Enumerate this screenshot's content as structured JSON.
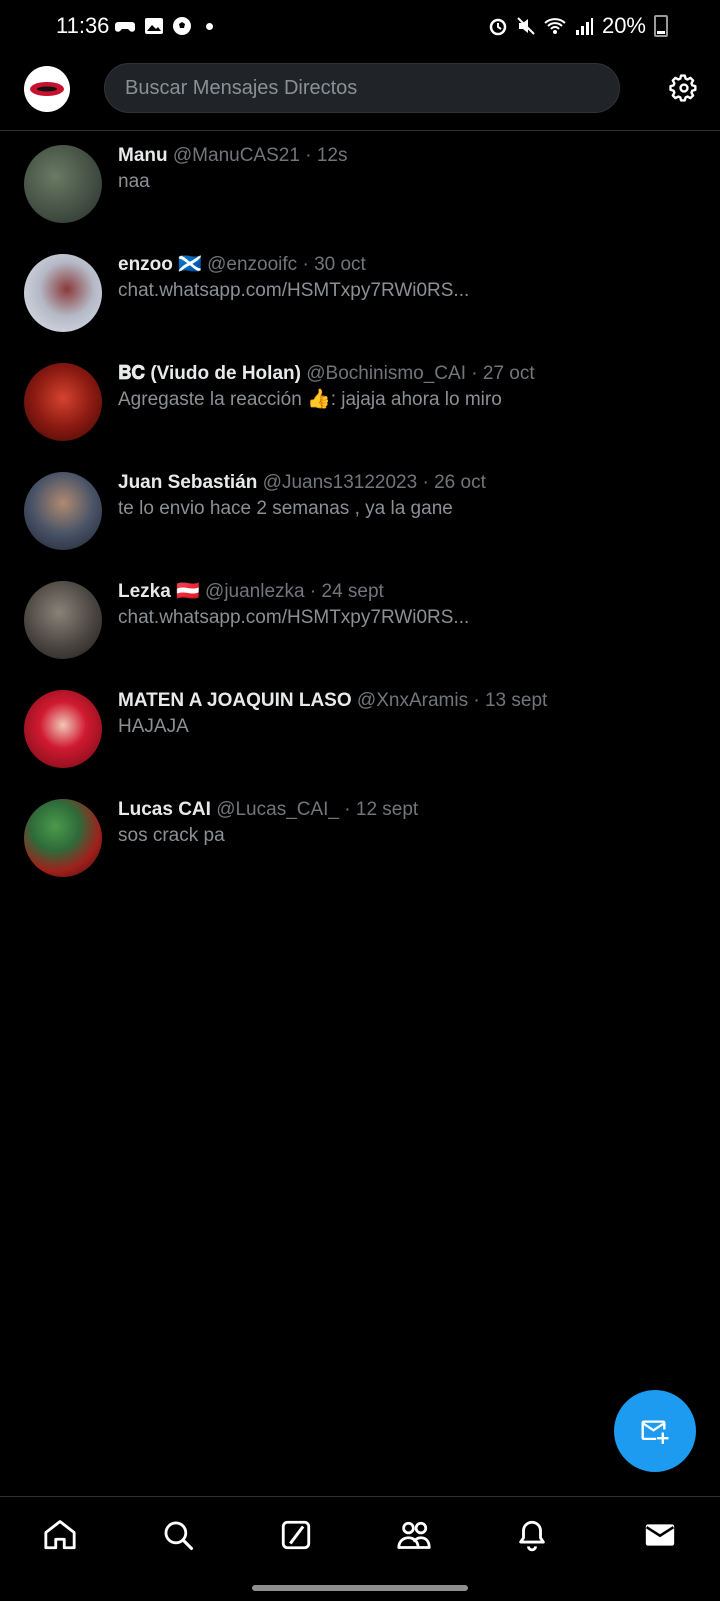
{
  "status_bar": {
    "time": "11:36",
    "battery": "20%"
  },
  "header": {
    "search_placeholder": "Buscar Mensajes Directos"
  },
  "conversations": [
    {
      "name": "Manu",
      "handle": "@ManuCAS21",
      "time": "12s",
      "preview": "naa",
      "avatar_color": "#3c4a3a"
    },
    {
      "name": "enzoo 🏴󠁧󠁢󠁳󠁣󠁴󠁿",
      "handle": "@enzooifc",
      "time": "30 oct",
      "preview": "chat.whatsapp.com/HSMTxpy7RWi0RS...",
      "avatar_color": "#c7cbd6"
    },
    {
      "name": "𝐁𝐂 (Viudo de Holan)",
      "handle": "@Bochinismo_CAI",
      "time": "27 oct",
      "preview": "Agregaste la reacción 👍: jajaja ahora lo miro",
      "avatar_color": "#8c1a12"
    },
    {
      "name": "Juan Sebastián",
      "handle": "@Juans13122023",
      "time": "26 oct",
      "preview": "te lo envio hace 2 semanas , ya la gane",
      "avatar_color": "#4a5468"
    },
    {
      "name": "Lezka 🇦🇹",
      "handle": "@juanlezka",
      "time": "24 sept",
      "preview": "chat.whatsapp.com/HSMTxpy7RWi0RS...",
      "avatar_color": "#5a5550"
    },
    {
      "name": "MATEN A JOAQUIN LASO",
      "handle": "@XnxAramis",
      "time": "13 sept",
      "preview": "HAJAJA",
      "avatar_color": "#c0182b"
    },
    {
      "name": "Lucas CAI",
      "handle": "@Lucas_CAI_",
      "time": "12 sept",
      "preview": "sos crack pa",
      "avatar_color": "#2e6b3a"
    }
  ],
  "colors": {
    "accent": "#1d9bf0",
    "background": "#000000"
  }
}
